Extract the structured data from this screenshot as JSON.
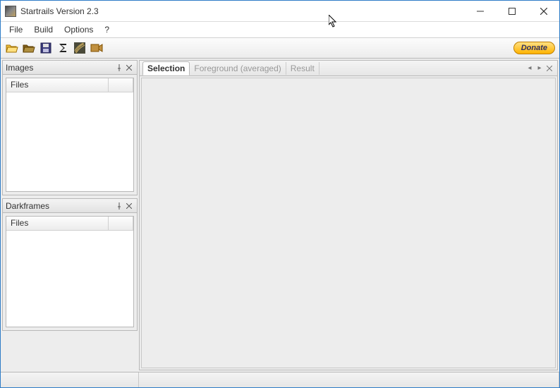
{
  "window": {
    "title": "Startrails Version 2.3"
  },
  "menu": {
    "file": "File",
    "build": "Build",
    "options": "Options",
    "help": "?"
  },
  "toolbar": {
    "donate_label": "Donate"
  },
  "tool_icons": {
    "open": "open-folder-icon",
    "open_dark": "open-dark-icon",
    "save": "save-icon",
    "sigma": "sigma-icon",
    "startrails": "startrails-icon",
    "video": "video-icon"
  },
  "panels": {
    "images": {
      "title": "Images",
      "col_files": "Files"
    },
    "darkframes": {
      "title": "Darkframes",
      "col_files": "Files"
    }
  },
  "tabs": {
    "selection": "Selection",
    "foreground": "Foreground (averaged)",
    "result": "Result"
  }
}
